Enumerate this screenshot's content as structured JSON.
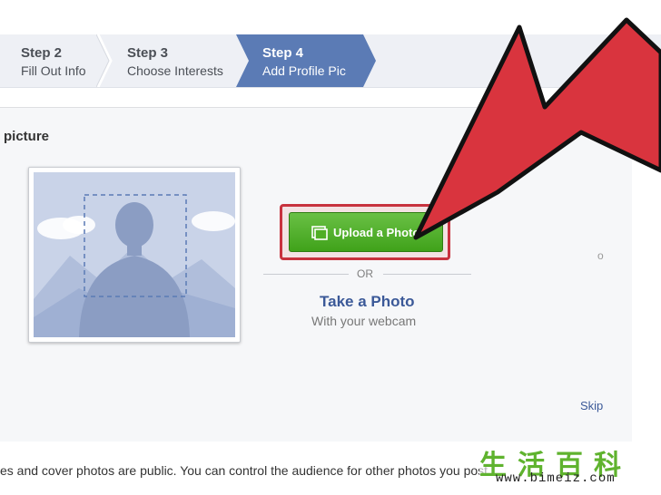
{
  "steps": [
    {
      "step": "Step 2",
      "label": "Fill Out Info"
    },
    {
      "step": "Step 3",
      "label": "Choose Interests"
    },
    {
      "step": "Step 4",
      "label": "Add Profile Pic"
    }
  ],
  "section_title": "picture",
  "upload": {
    "label": "Upload a Photo"
  },
  "or_label": "OR",
  "take_photo": {
    "label": "Take a Photo",
    "sub": "With your webcam"
  },
  "skip_label": "Skip",
  "right_hint": "o",
  "bottom_text": "es and cover photos are public. You can control the audience for other photos you post.",
  "watermark": {
    "cn": "生活百科",
    "url": "www.bimeiz.com"
  },
  "colors": {
    "active_step": "#5b7bb5",
    "upload_button": "#4fae25",
    "arrow": "#d9343e",
    "link": "#3b5998"
  }
}
